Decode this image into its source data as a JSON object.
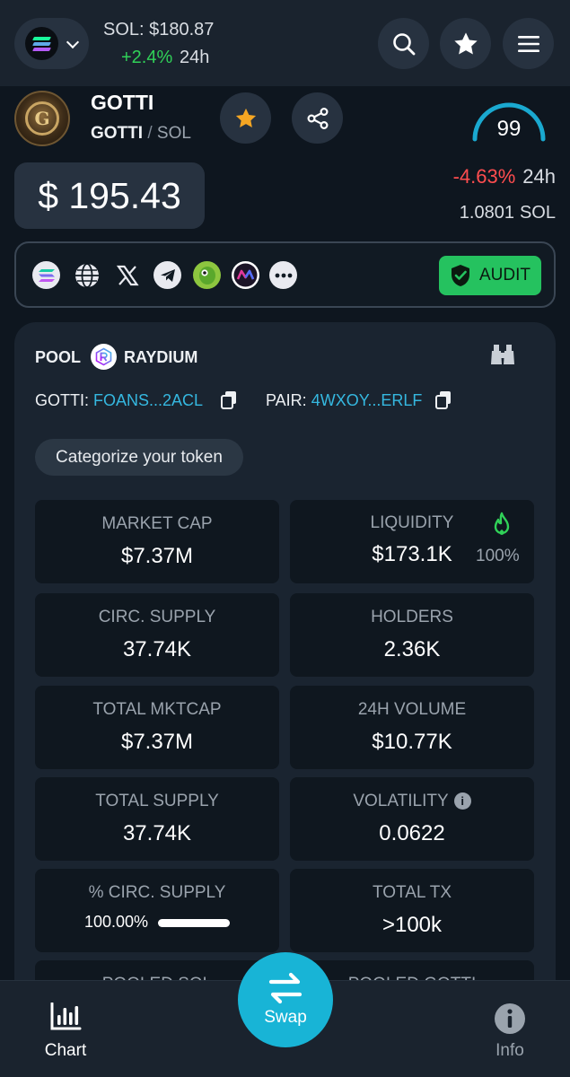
{
  "topbar": {
    "sol_price": "SOL: $180.87",
    "sol_change": "+2.4%",
    "sol_change_period": "24h"
  },
  "token": {
    "name": "GOTTI",
    "base": "GOTTI",
    "separator": "/",
    "quote": "SOL",
    "score": "99",
    "price": "$ 195.43",
    "change": "-4.63%",
    "change_period": "24h",
    "price_in_quote": "1.0801",
    "price_in_quote_unit": "SOL"
  },
  "links": {
    "icons": [
      "solana-icon",
      "globe-icon",
      "x-icon",
      "telegram-icon",
      "coingecko-icon",
      "moontok-icon",
      "more-icon"
    ],
    "audit_label": "AUDIT"
  },
  "pool": {
    "label": "POOL",
    "dex": "RAYDIUM",
    "token_label": "GOTTI:",
    "token_address": "FOANS...2ACL",
    "pair_label": "PAIR:",
    "pair_address": "4WXOY...ERLF",
    "categorize_label": "Categorize your token"
  },
  "stats": {
    "market_cap": {
      "label": "MARKET CAP",
      "value": "$7.37M"
    },
    "liquidity": {
      "label": "LIQUIDITY",
      "value": "$173.1K",
      "percent": "100%"
    },
    "circ_supply": {
      "label": "CIRC. SUPPLY",
      "value": "37.74K"
    },
    "holders": {
      "label": "HOLDERS",
      "value": "2.36K"
    },
    "total_mktcap": {
      "label": "TOTAL MKTCAP",
      "value": "$7.37M"
    },
    "volume_24h": {
      "label": "24H VOLUME",
      "value": "$10.77K"
    },
    "total_supply": {
      "label": "TOTAL SUPPLY",
      "value": "37.74K"
    },
    "volatility": {
      "label": "VOLATILITY",
      "value": "0.0622"
    },
    "pct_circ_supply": {
      "label": "% CIRC. SUPPLY",
      "value": "100.00%",
      "fill": 1.0
    },
    "total_tx": {
      "label": "TOTAL TX",
      "value": ">100k"
    },
    "pooled_sol": {
      "label": "POOLED SOL"
    },
    "pooled_gotti": {
      "label": "POOLED GOTTI"
    }
  },
  "nav": {
    "chart_label": "Chart",
    "swap_label": "Swap",
    "info_label": "Info"
  },
  "colors": {
    "background": "#0e161f",
    "positive": "#30d158",
    "negative": "#ff4d4f",
    "accent": "#18b4d6",
    "audit": "#25c25f",
    "address": "#35b8e0",
    "favorite": "#f5a623"
  }
}
